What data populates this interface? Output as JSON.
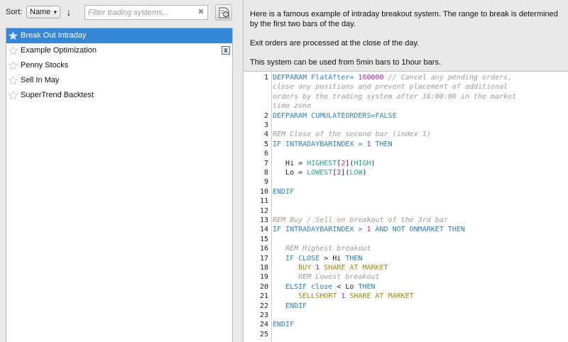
{
  "toolbar": {
    "sort_label": "Sort:",
    "sort_value": "Name",
    "sort_direction_icon": "arrow-down-icon",
    "filter_placeholder": "Filter trading systems...",
    "help_icon": "help-document-icon"
  },
  "systems": [
    {
      "label": "Break Out Intraday",
      "selected": true
    },
    {
      "label": "Example Optimization",
      "selected": false,
      "badge": "optimization-icon"
    },
    {
      "label": "Penny Stocks",
      "selected": false
    },
    {
      "label": "Sell In May",
      "selected": false
    },
    {
      "label": "SuperTrend Backtest",
      "selected": false
    }
  ],
  "description": {
    "p1": "Here is a famous example of intraday breakout system. The range to break is determined by the first two bars of the day.",
    "p2": "Exit orders are processed at the close of the day.",
    "p3": "This system can be used from 5min bars to 1hour bars."
  },
  "colors": {
    "selection": "#3586d4",
    "keyword": "#2a7fc4",
    "comment": "#9a9a9a",
    "number": "#b020b0",
    "function": "#27a38e",
    "action": "#a08a12"
  },
  "code": [
    {
      "n": "1",
      "rows": [
        [
          [
            "kw",
            "DEFPARAM FlatAfter= "
          ],
          [
            "num",
            "160000"
          ],
          [
            "cmt",
            " // Cancel any pending orders,"
          ]
        ],
        [
          [
            "cmt",
            "close any positions and prevent placement of additional"
          ]
        ],
        [
          [
            "cmt",
            "orders by the trading system after 16:00:00 in the market"
          ]
        ],
        [
          [
            "cmt",
            "time zone"
          ]
        ]
      ]
    },
    {
      "n": "2",
      "rows": [
        [
          [
            "kw",
            "DEFPARAM CUMULATEORDERS=FALSE"
          ]
        ]
      ]
    },
    {
      "n": "3",
      "rows": [
        []
      ]
    },
    {
      "n": "4",
      "rows": [
        [
          [
            "cmt",
            "REM Close of the second bar (index 1)"
          ]
        ]
      ]
    },
    {
      "n": "5",
      "rows": [
        [
          [
            "kw",
            "IF INTRADAYBARINDEX = "
          ],
          [
            "num",
            "1"
          ],
          [
            "kw",
            " THEN"
          ]
        ]
      ]
    },
    {
      "n": "6",
      "rows": [
        []
      ]
    },
    {
      "n": "7",
      "rows": [
        [
          [
            "plain",
            "   Hi = "
          ],
          [
            "fn",
            "HIGHEST"
          ],
          [
            "plain",
            "["
          ],
          [
            "num",
            "2"
          ],
          [
            "plain",
            "]("
          ],
          [
            "fn",
            "HIGH"
          ],
          [
            "plain",
            ")"
          ]
        ]
      ]
    },
    {
      "n": "8",
      "rows": [
        [
          [
            "plain",
            "   Lo = "
          ],
          [
            "fn",
            "LOWEST"
          ],
          [
            "plain",
            "["
          ],
          [
            "num",
            "2"
          ],
          [
            "plain",
            "]("
          ],
          [
            "fn",
            "LOW"
          ],
          [
            "plain",
            ")"
          ]
        ]
      ]
    },
    {
      "n": "9",
      "rows": [
        []
      ]
    },
    {
      "n": "10",
      "rows": [
        [
          [
            "kw",
            "ENDIF"
          ]
        ]
      ]
    },
    {
      "n": "11",
      "rows": [
        []
      ]
    },
    {
      "n": "12",
      "rows": [
        []
      ]
    },
    {
      "n": "13",
      "rows": [
        [
          [
            "cmt",
            "REM Buy / Sell on breakout of the 3rd bar"
          ]
        ]
      ]
    },
    {
      "n": "14",
      "rows": [
        [
          [
            "kw",
            "IF INTRADAYBARINDEX > "
          ],
          [
            "num",
            "1"
          ],
          [
            "kw",
            " AND NOT ONMARKET THEN"
          ]
        ]
      ]
    },
    {
      "n": "15",
      "rows": [
        []
      ]
    },
    {
      "n": "16",
      "rows": [
        [
          [
            "cmt",
            "   REM Highest breakout"
          ]
        ]
      ]
    },
    {
      "n": "17",
      "rows": [
        [
          [
            "kw",
            "   IF CLOSE "
          ],
          [
            "plain",
            "> Hi "
          ],
          [
            "kw",
            "THEN"
          ]
        ]
      ]
    },
    {
      "n": "18",
      "rows": [
        [
          [
            "act",
            "      BUY "
          ],
          [
            "num",
            "1"
          ],
          [
            "act",
            " SHARE AT MARKET"
          ]
        ]
      ]
    },
    {
      "n": "19",
      "rows": [
        [
          [
            "cmt",
            "      REM Lowest breakout"
          ]
        ]
      ]
    },
    {
      "n": "20",
      "rows": [
        [
          [
            "kw",
            "   ELSIF close "
          ],
          [
            "plain",
            "< Lo "
          ],
          [
            "kw",
            "THEN"
          ]
        ]
      ]
    },
    {
      "n": "21",
      "rows": [
        [
          [
            "act",
            "      SELLSHORT "
          ],
          [
            "num",
            "1"
          ],
          [
            "act",
            " SHARE AT MARKET"
          ]
        ]
      ]
    },
    {
      "n": "22",
      "rows": [
        [
          [
            "kw",
            "   ENDIF"
          ]
        ]
      ]
    },
    {
      "n": "23",
      "rows": [
        []
      ]
    },
    {
      "n": "24",
      "rows": [
        [
          [
            "kw",
            "ENDIF"
          ]
        ]
      ]
    },
    {
      "n": "25",
      "rows": [
        []
      ]
    }
  ]
}
